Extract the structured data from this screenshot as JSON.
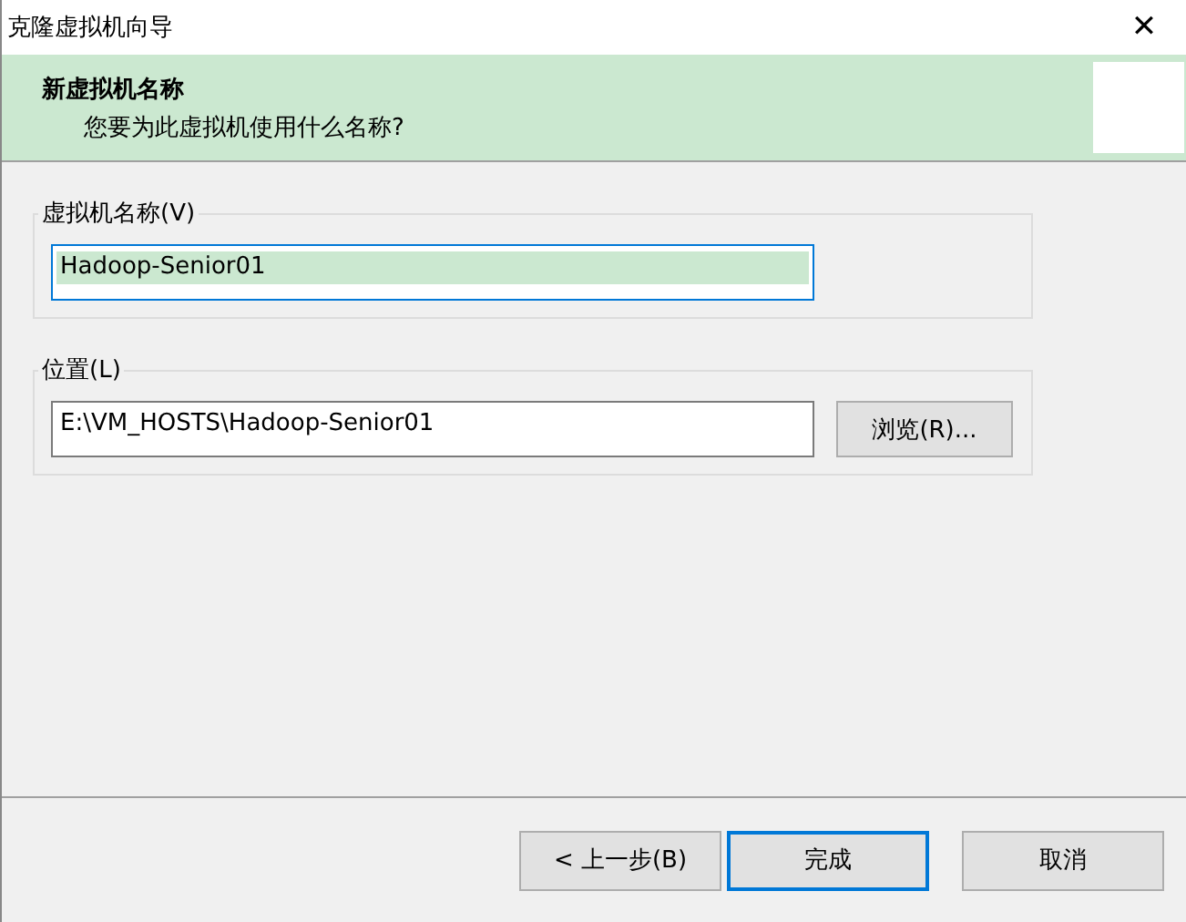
{
  "window": {
    "title": "克隆虚拟机向导",
    "close": "✕"
  },
  "header": {
    "title": "新虚拟机名称",
    "subtitle": "您要为此虚拟机使用什么名称?"
  },
  "name_group": {
    "label": "虚拟机名称(V)",
    "value": "Hadoop-Senior01",
    "text_selected": true,
    "focused": true
  },
  "location_group": {
    "label": "位置(L)",
    "value": "E:\\VM_HOSTS\\Hadoop-Senior01",
    "browse": "浏览(R)..."
  },
  "buttons": [
    {
      "label": "< 上一步(B)",
      "focused": false
    },
    {
      "label": "完成",
      "focused": true
    },
    {
      "label": "取消",
      "focused": false
    }
  ]
}
